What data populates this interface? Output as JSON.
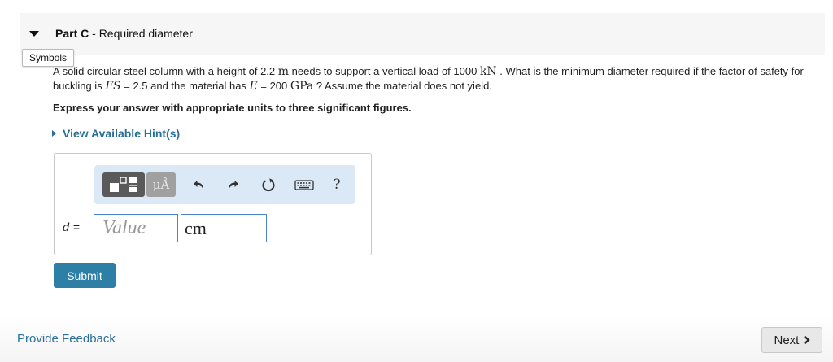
{
  "part": {
    "label": "Part C",
    "separator": " - ",
    "title": "Required diameter"
  },
  "symbols_tab": "Symbols",
  "problem": {
    "t1": "A solid circular steel column with a height of 2.2",
    "m1": "m",
    "t2": " needs to support a vertical load of 1000",
    "m2": "kN",
    "t3": " . What is the minimum diameter required if the factor of safety for buckling is ",
    "fs": "FS",
    "t4": " = 2.5 and the material has ",
    "e": "E",
    "t5": " = 200",
    "m3": "GPa",
    "t6": " ? Assume the material does not yield."
  },
  "instructions": "Express your answer with appropriate units to three significant figures.",
  "hint_link": "View Available Hint(s)",
  "toolbar": {
    "units_label": "μÅ",
    "help_label": "?"
  },
  "answer": {
    "variable": "d",
    "equals": " =",
    "value_placeholder": "Value",
    "value": "",
    "unit": "cm"
  },
  "submit_label": "Submit",
  "feedback_label": "Provide Feedback",
  "next_label": "Next"
}
